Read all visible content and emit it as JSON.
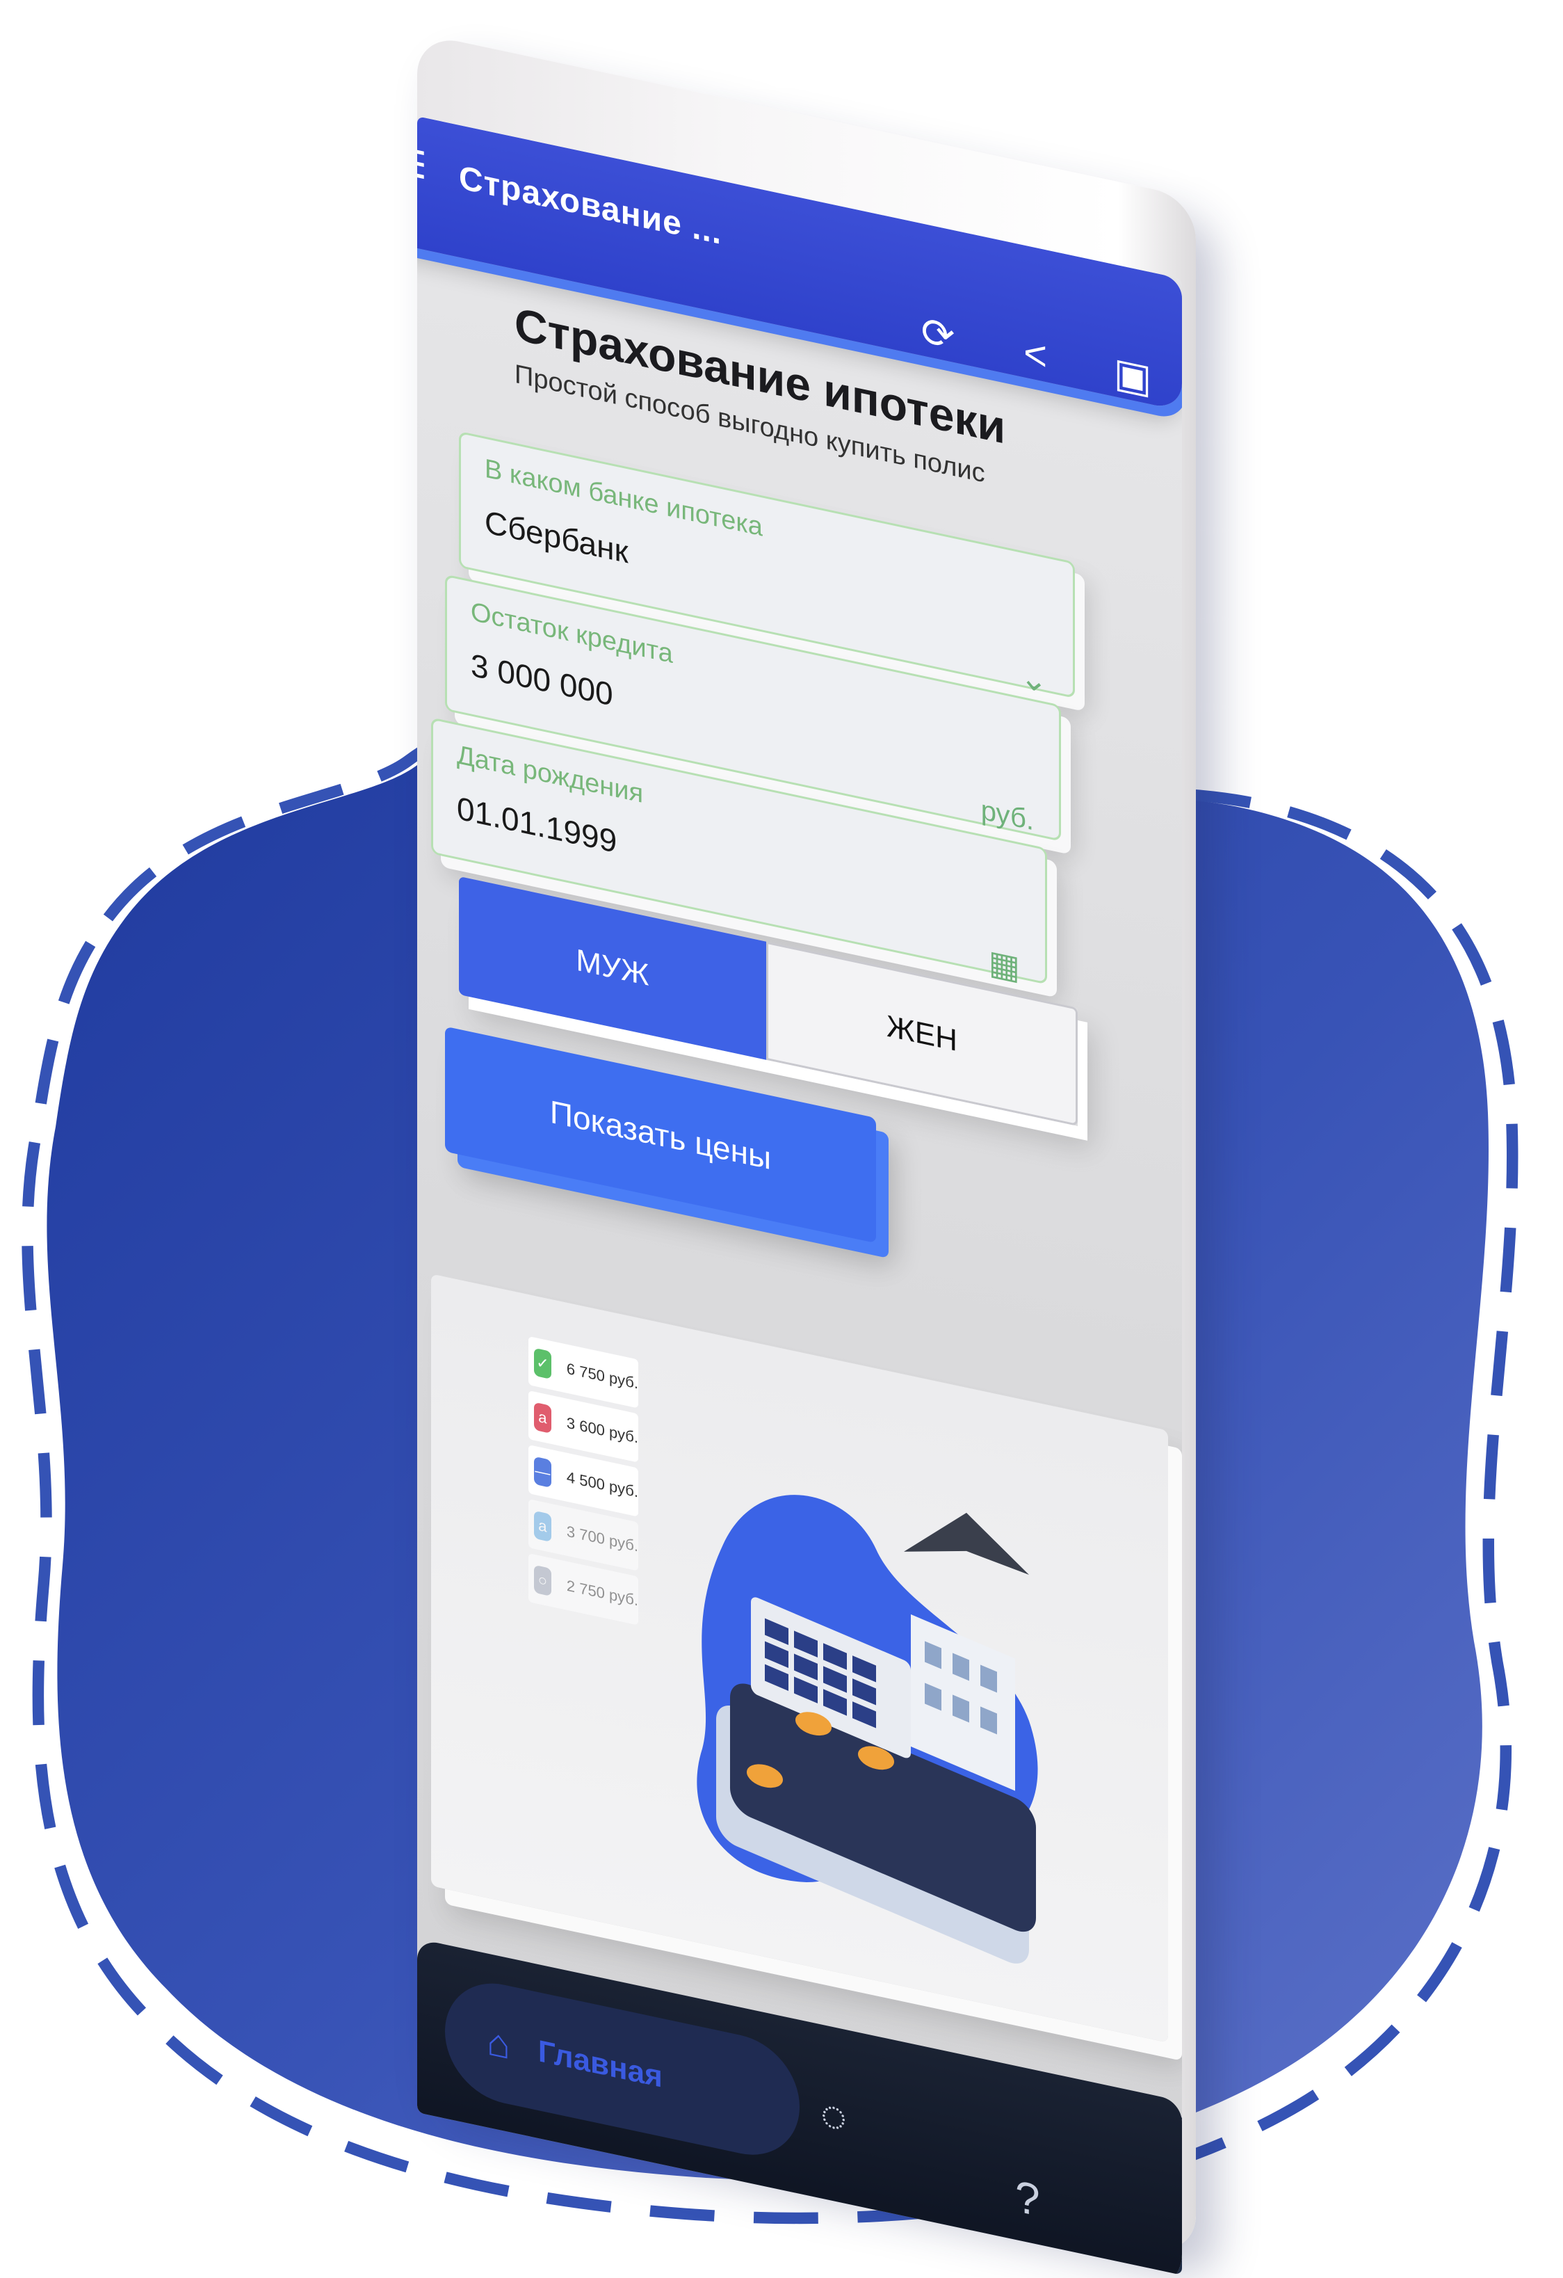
{
  "appbar": {
    "menu_icon": "menu-icon",
    "title": "Страхование ...",
    "icons": [
      "refresh-icon",
      "share-icon",
      "qr-scan-icon"
    ]
  },
  "page": {
    "heading": "Страхование ипотеки",
    "subheading": "Простой способ выгодно купить полис"
  },
  "form": {
    "bank": {
      "label": "В каком банке ипотека",
      "value": "Сбербанк",
      "icon": "chevron-down-icon"
    },
    "loan": {
      "label": "Остаток кредита",
      "value": "3 000 000",
      "suffix": "руб."
    },
    "birth": {
      "label": "Дата рождения",
      "value": "01.01.1999",
      "icon": "calendar-icon"
    },
    "gender": {
      "options": [
        "МУЖ",
        "ЖЕН"
      ],
      "selected": "МУЖ"
    },
    "submit": "Показать цены"
  },
  "promo": {
    "prices": [
      {
        "amount": "6 750",
        "unit": "руб.",
        "color": "#5cc06a"
      },
      {
        "amount": "3 600",
        "unit": "руб.",
        "color": "#e05d6e"
      },
      {
        "amount": "4 500",
        "unit": "руб.",
        "color": "#5a7fe0"
      },
      {
        "amount": "3 700",
        "unit": "руб.",
        "color": "#5aa8e6"
      },
      {
        "amount": "2 750",
        "unit": "руб.",
        "color": "#9aa3b4"
      }
    ]
  },
  "navbar": {
    "home": {
      "label": "Главная",
      "icon": "home-icon"
    },
    "chat_icon": "chat-icon",
    "help_icon": "help-icon"
  },
  "colors": {
    "brand_blue": "#3a4fd6",
    "accent_blue": "#3e6ef0",
    "field_green": "#78b77a",
    "nav_dark": "#121a2a"
  }
}
